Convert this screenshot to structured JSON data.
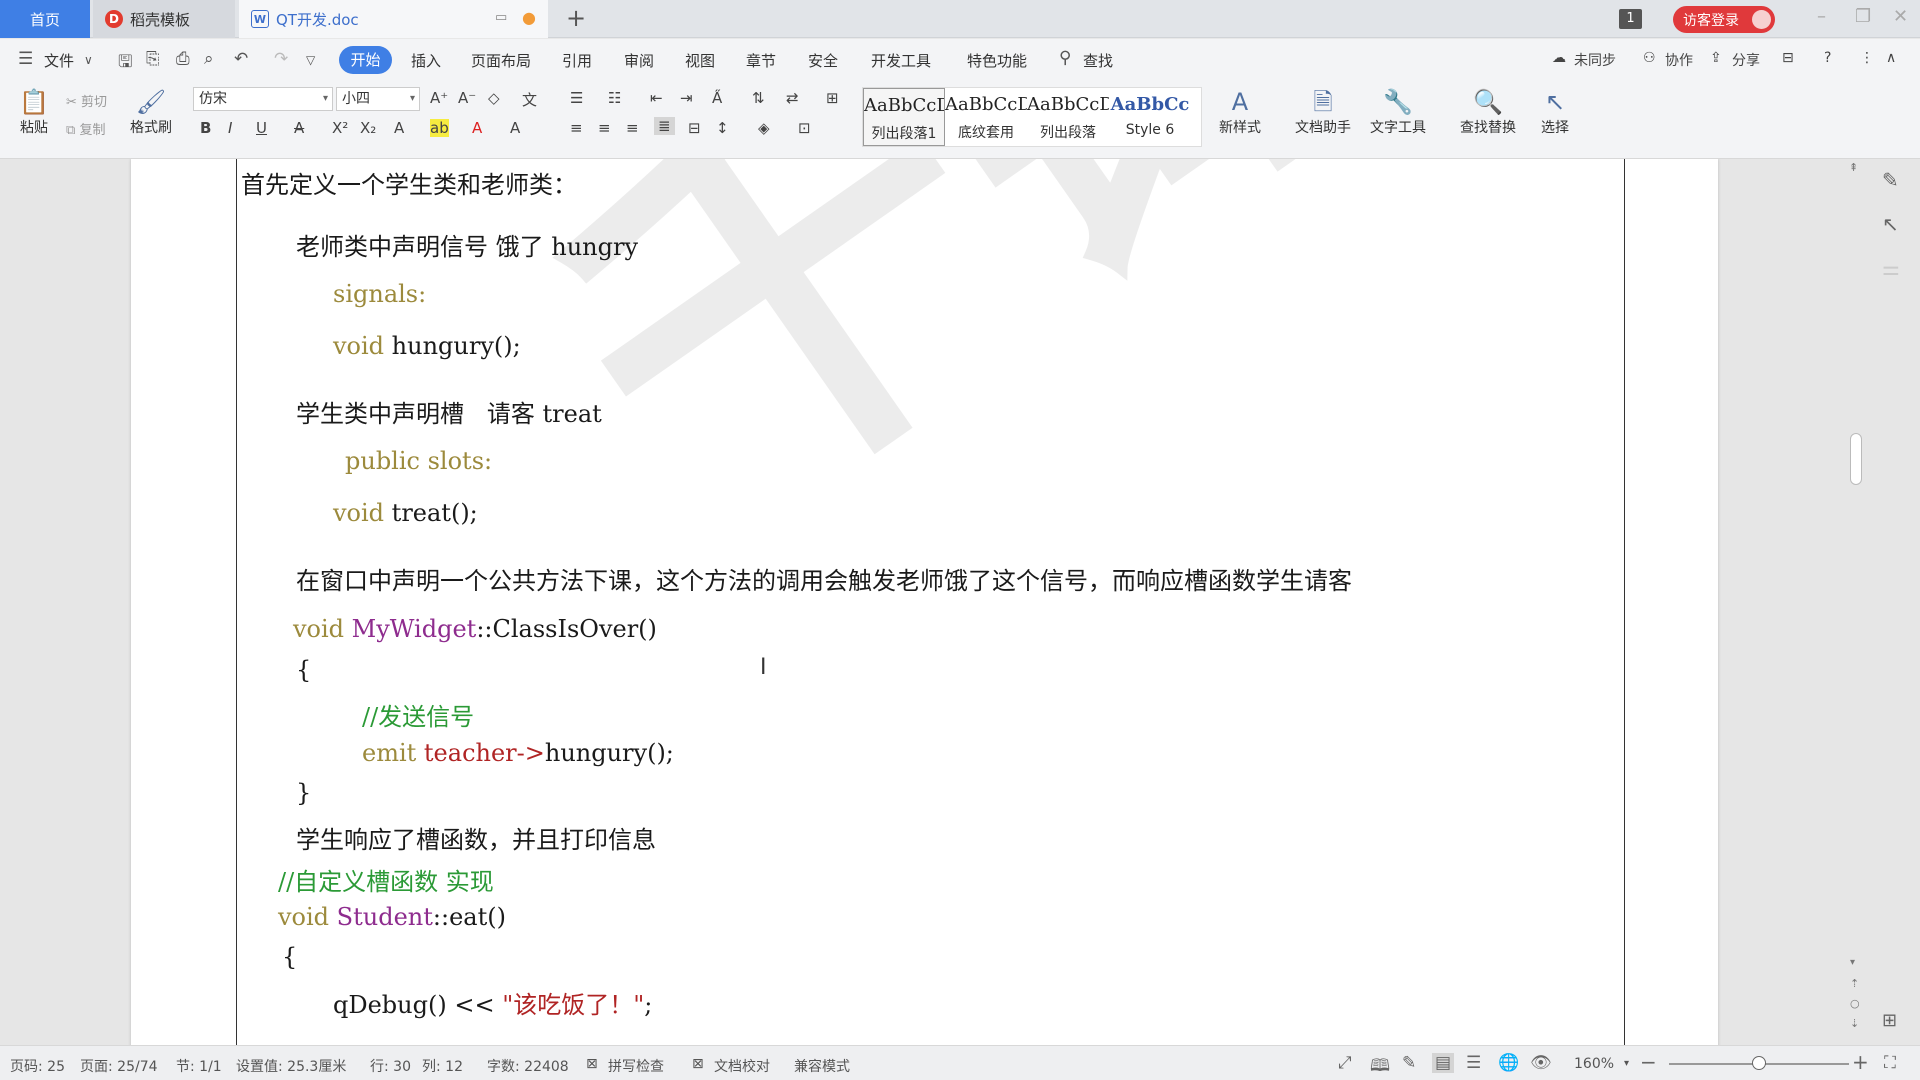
{
  "tabs": {
    "home": "首页",
    "template": "稻壳模板",
    "doc": "QT开发.doc",
    "new_tab": "+"
  },
  "topright": {
    "badge": "1",
    "login": "访客登录"
  },
  "menu": {
    "file": "文件",
    "start": "开始",
    "insert": "插入",
    "layout": "页面布局",
    "reference": "引用",
    "review": "审阅",
    "view": "视图",
    "chapter": "章节",
    "security": "安全",
    "devtools": "开发工具",
    "special": "特色功能",
    "search": "查找",
    "unsync": "未同步",
    "collab": "协作",
    "share": "分享"
  },
  "ribbon": {
    "paste": "粘贴",
    "cut": "剪切",
    "copy": "复制",
    "format_painter": "格式刷",
    "font_name": "仿宋",
    "font_size": "小四",
    "styles": [
      {
        "preview": "AaBbCcDd",
        "label": "列出段落1"
      },
      {
        "preview": "AaBbCcDd",
        "label": "底纹套用"
      },
      {
        "preview": "AaBbCcDd",
        "label": "列出段落"
      },
      {
        "preview": "AaBbCc",
        "label": "Style 6"
      }
    ],
    "new_style": "新样式",
    "doc_assistant": "文档助手",
    "text_tools": "文字工具",
    "find_replace": "查找替换",
    "select": "选择"
  },
  "document": {
    "l1": "首先定义一个学生类和老师类：",
    "l2": "老师类中声明信号 饿了 hungry",
    "l3": "signals:",
    "l4_kw": "void",
    "l4_fn": " hungury();",
    "l5": "学生类中声明槽   请客 treat",
    "l6": "public slots:",
    "l7_kw": "void",
    "l7_fn": " treat();",
    "l8": "在窗口中声明一个公共方法下课，这个方法的调用会触发老师饿了这个信号，而响应槽函数学生请客",
    "l9_kw": "void",
    "l9_cls": " MyWidget",
    "l9_fn": "::ClassIsOver()",
    "l10": "{",
    "l11": "//发送信号",
    "l12_kw": "emit",
    "l12_id": " teacher->",
    "l12_fn": "hungury();",
    "l13": "}",
    "l14": "学生响应了槽函数，并且打印信息",
    "l15": "//自定义槽函数 实现",
    "l16_kw": "void",
    "l16_cls": " Student",
    "l16_fn": "::eat()",
    "l17": "{",
    "l18_fn": "qDebug() << ",
    "l18_str": "\"该吃饭了！\"",
    "l18_end": ";",
    "watermark": "千锋教育"
  },
  "status": {
    "page_code": "页码: 25",
    "page": "页面: 25/74",
    "section": "节: 1/1",
    "setting": "设置值: 25.3厘米",
    "row": "行: 30",
    "col": "列: 12",
    "word_count": "字数: 22408",
    "spellcheck": "拼写检查",
    "doc_proof": "文档校对",
    "compat": "兼容模式",
    "zoom": "160%"
  },
  "colors": {
    "accent": "#3f7fe5",
    "login": "#e0393b",
    "keyword": "#9c8a3c",
    "class": "#8e2c8e",
    "comment": "#2b9a36",
    "string": "#b02424"
  },
  "zoom_level": 0.5
}
